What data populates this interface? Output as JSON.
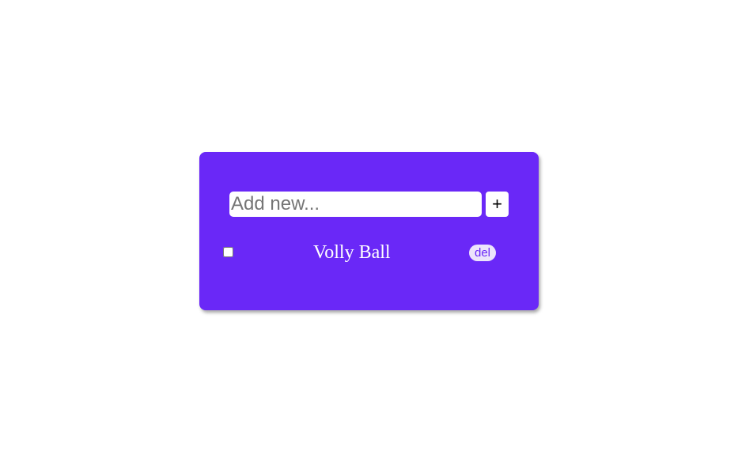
{
  "form": {
    "input_placeholder": "Add new...",
    "input_value": "",
    "add_label": "+"
  },
  "todos": [
    {
      "label": "Volly Ball",
      "checked": false,
      "delete_label": "del"
    }
  ],
  "colors": {
    "card_background": "#6a28f7",
    "item_text": "#ffffff",
    "delete_pill_background": "#ece4fb",
    "delete_pill_text": "#6a28f7"
  }
}
